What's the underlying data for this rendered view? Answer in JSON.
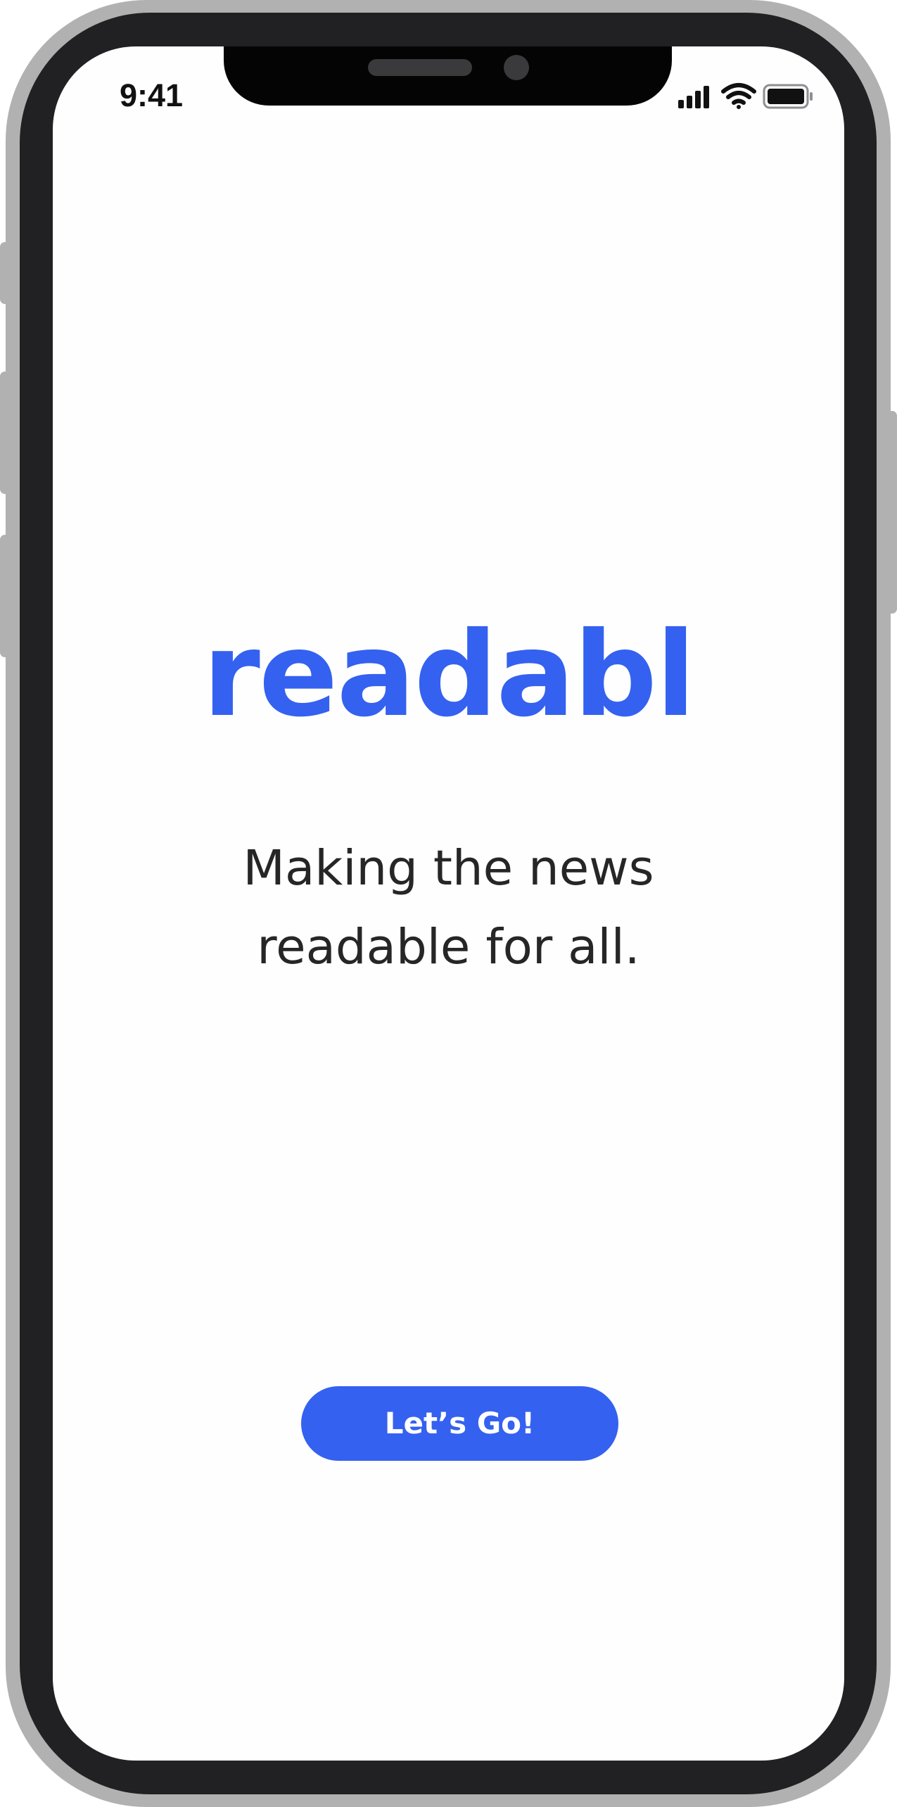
{
  "status_bar": {
    "time": "9:41",
    "icons": [
      "cellular-signal-icon",
      "wifi-icon",
      "battery-icon"
    ]
  },
  "app": {
    "title": "readabl",
    "tagline": "Making the news readable for all.",
    "cta_label": "Let’s Go!"
  },
  "colors": {
    "brand": "#3461f0",
    "text": "#262626",
    "frame": "#212123",
    "bezel": "#b1b1b1",
    "screen": "#fefefe"
  }
}
